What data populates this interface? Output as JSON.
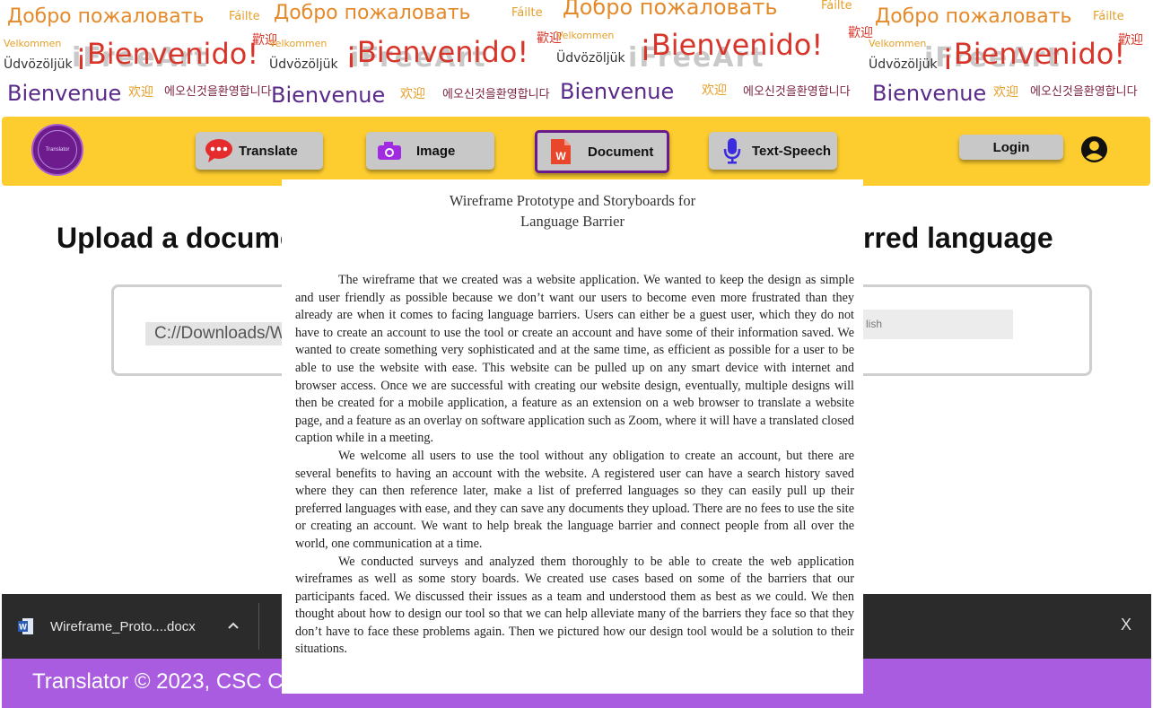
{
  "banner": {
    "words": {
      "welcome_ru": "Добро пожаловать",
      "welcome_ga": "Fáilte",
      "welcome_es": "¡Bienvenido!",
      "welcome_da": "Velkommen",
      "welcome_hu": "Üdvözöljük",
      "welcome_fr": "Bienvenue",
      "welcome_zh": "欢迎",
      "welcome_zh_trad": "歡迎",
      "welcome_ko": "에오신것을환영합니다",
      "watermark": "iFreeArt"
    }
  },
  "nav": {
    "logo_text": "Translator",
    "buttons": [
      {
        "label": "Translate",
        "icon": "chat-bubble-icon"
      },
      {
        "label": "Image",
        "icon": "camera-icon"
      },
      {
        "label": "Document",
        "icon": "word-document-icon"
      },
      {
        "label": "Text-Speech",
        "icon": "microphone-icon"
      }
    ],
    "active_button": "Document",
    "login_label": "Login",
    "user_icon": "user-circle-icon"
  },
  "main": {
    "heading_left": "Upload a docume",
    "heading_right": "rred language",
    "file_path": "C://Downloads/W",
    "language_value": "lish"
  },
  "download_bar": {
    "file_name": "Wireframe_Proto....docx",
    "close_label": "X"
  },
  "footer": {
    "text": "Translator ©  2023, CSC C"
  },
  "document": {
    "title_line1": "Wireframe Prototype and Storyboards for",
    "title_line2": "Language Barrier",
    "paragraphs": [
      "The wireframe that we created was a website application. We wanted to keep the design as simple and user friendly as possible because we don’t want our users to become even more frustrated than they already are when it comes to facing language barriers. Users can either be a guest user, which they do not have to create an account to use the tool or create an account and have some of their information saved. We wanted to create something very sophisticated and at the same time, as efficient as possible for a user to be able to use the website with ease. This website can be pulled up on any smart device with internet and browser access. Once we are successful with creating our website design, eventually, multiple designs will then be created for a mobile application, a feature as an extension on a web browser to translate a website page, and a feature as an overlay on software application such as Zoom, where it will have a translated closed caption while in a meeting.",
      "We welcome all users to use the tool without any obligation to create an account, but there are several benefits to having an account with the website. A registered user can have a search history saved where they can then reference later, make a list of preferred languages so they can easily pull up their preferred languages with ease, and they can save any documents they upload. There are no fees to use the site or creating an account. We want to help break the language barrier and connect people from all over the world, one communication at a time.",
      "We conducted surveys and analyzed them thoroughly to be able to create the web application wireframes as well as some story boards. We created use cases based on some of the barriers that our participants faced. We discussed their issues as a team and understood them as best as we could. We then thought about how to design our tool so that we can help alleviate many of the barriers they face so that they don’t have to face these problems again. Then we pictured how our design tool would be a solution to their situations."
    ]
  },
  "colors": {
    "nav_bg": "#fdcd2f",
    "footer_bg": "#a95ce0",
    "active_border": "#6b1a8e",
    "download_bar_bg": "#2b2b2b"
  }
}
